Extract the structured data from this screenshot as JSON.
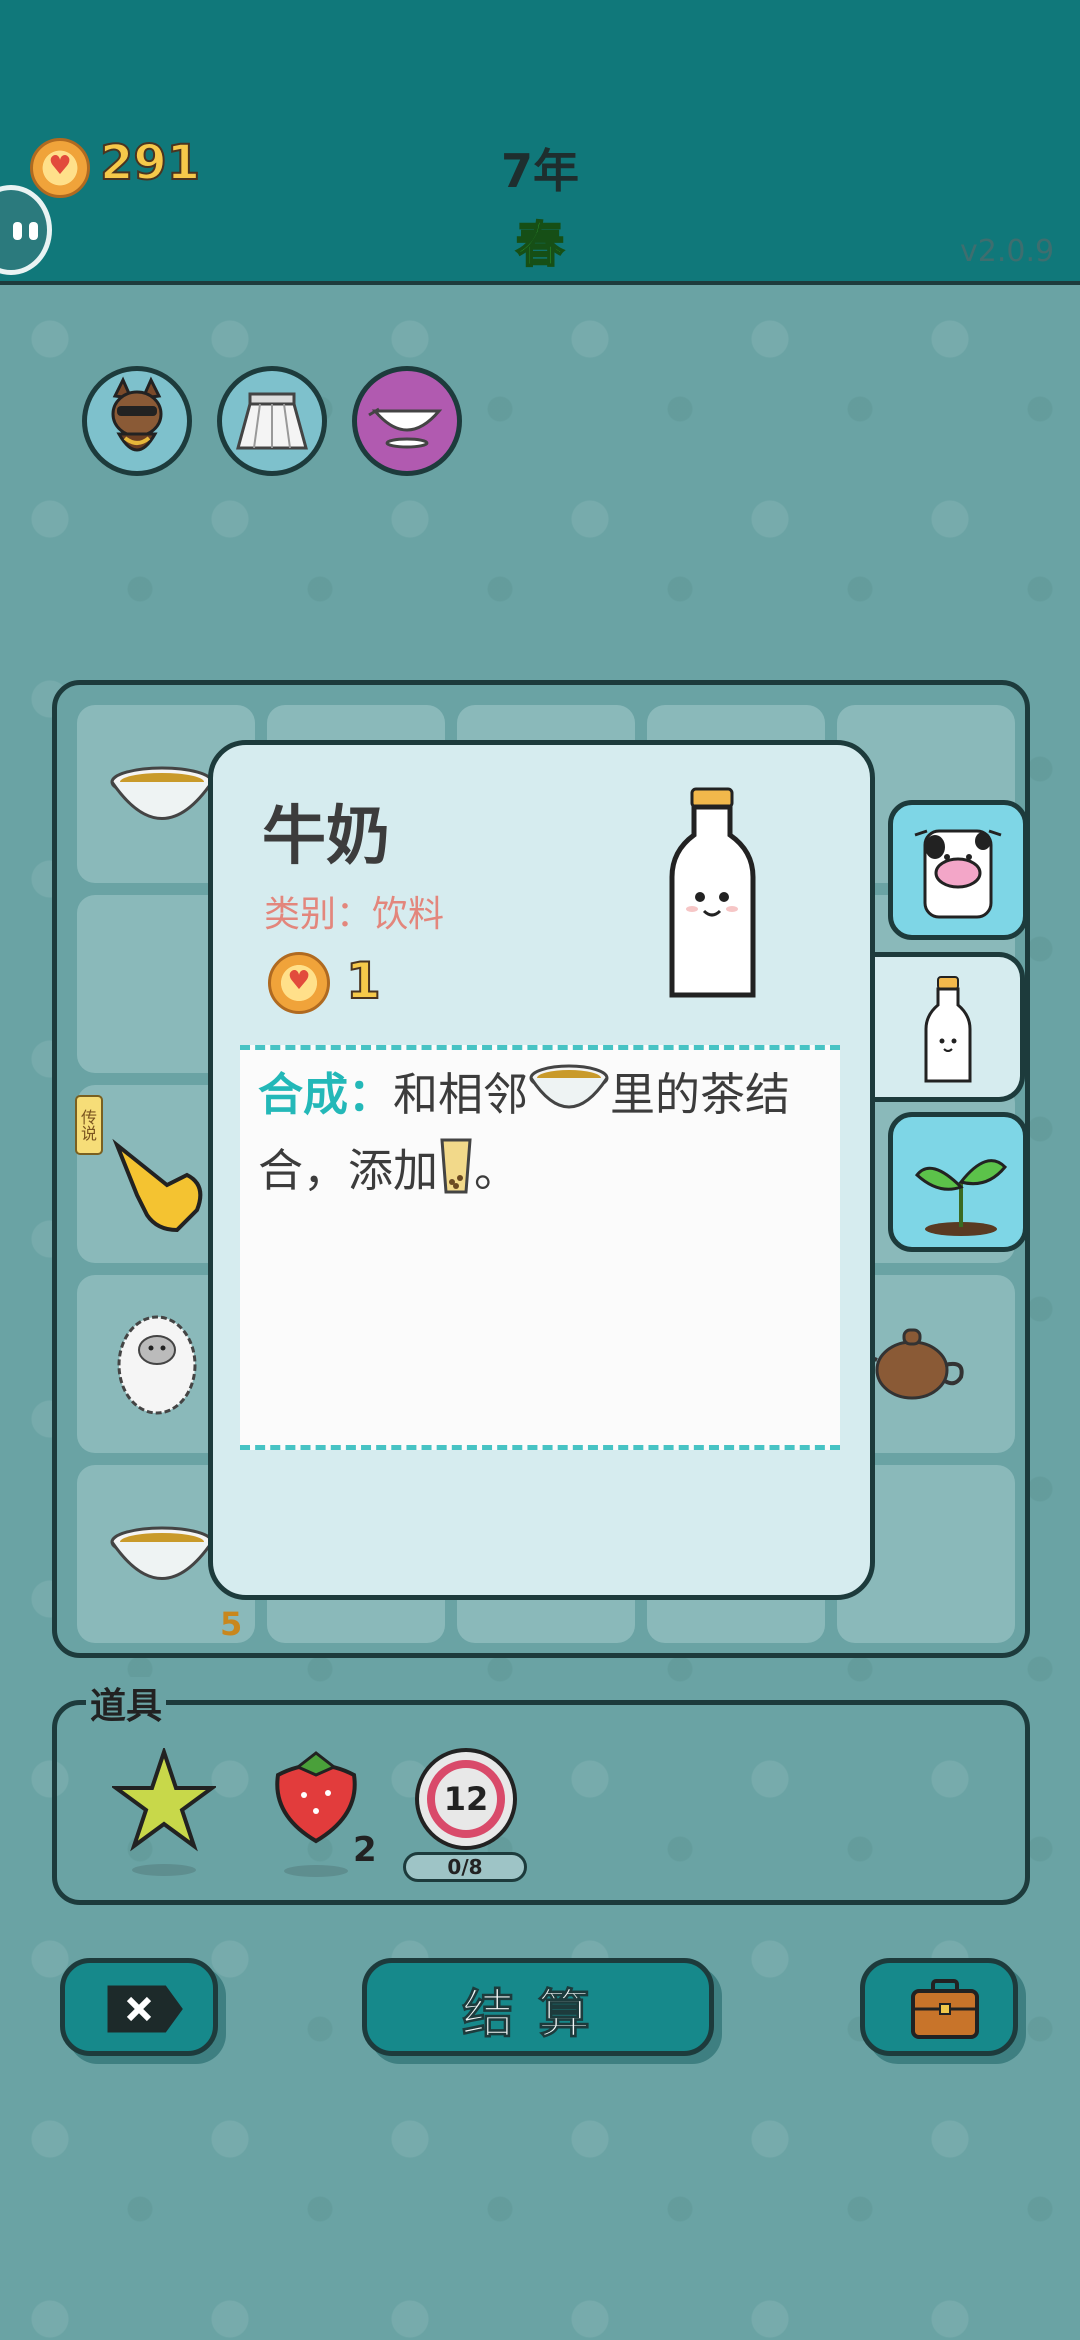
{
  "header": {
    "coins": "291",
    "year": "7年",
    "season": "春",
    "version": "v2.0.9"
  },
  "buffs": [
    "dog-with-sunglasses-icon",
    "skirt-icon",
    "gravy-boat-icon"
  ],
  "board": {
    "legend_tag": "传说",
    "count": "5"
  },
  "dialog": {
    "item_name": "牛奶",
    "category": "类别：饮料",
    "value": "1",
    "recipe_label": "合成：",
    "recipe_text_1": "和相邻",
    "recipe_text_2": "里的茶结合，添加",
    "recipe_text_3": "。"
  },
  "side_tabs": [
    "cow-icon",
    "milk-icon",
    "sprout-icon"
  ],
  "items": {
    "label": "道具",
    "strawberry_count": "2",
    "timer_number": "12",
    "timer_progress": "0/8"
  },
  "buttons": {
    "settle": "结算"
  },
  "colors": {
    "header": "#10787a",
    "accent": "#23b8b8",
    "background": "#6aa3a4"
  }
}
